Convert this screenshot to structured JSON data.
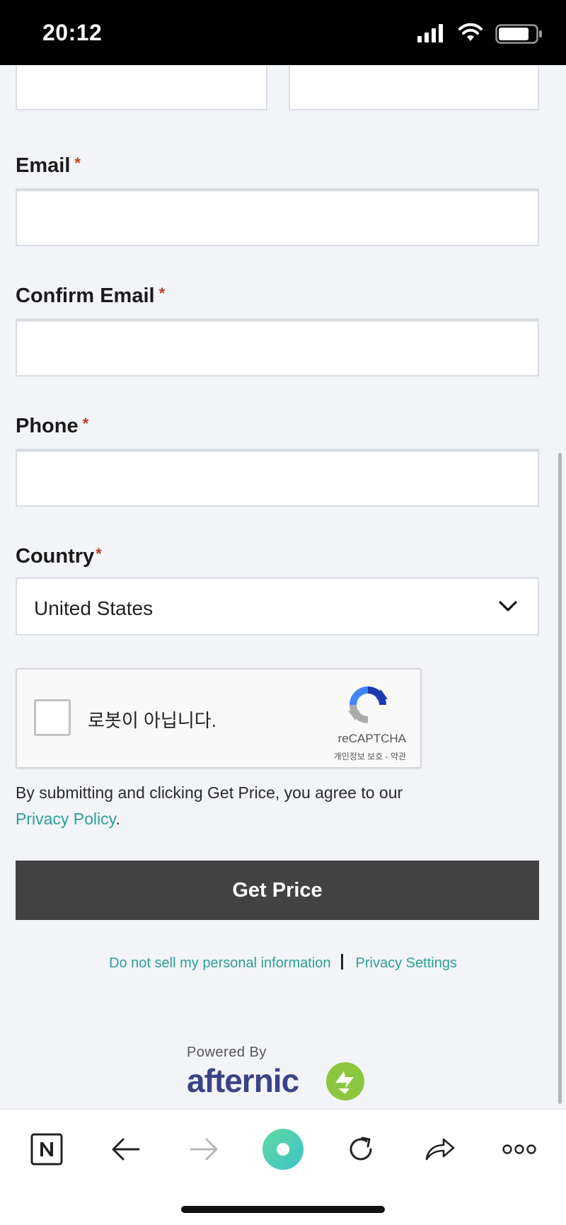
{
  "status_bar": {
    "time": "20:12"
  },
  "form": {
    "email": {
      "label": "Email",
      "required": "*",
      "value": ""
    },
    "confirm_email": {
      "label": "Confirm Email",
      "required": "*",
      "value": ""
    },
    "phone": {
      "label": "Phone",
      "required": "*",
      "value": ""
    },
    "country": {
      "label": "Country",
      "required": "*",
      "selected": "United States"
    }
  },
  "recaptcha": {
    "label": "로봇이 아닙니다.",
    "brand": "reCAPTCHA",
    "terms": "개인정보 보호 - 약관"
  },
  "agreement": {
    "text": "By submitting and clicking Get Price, you agree to our ",
    "link": "Privacy Policy",
    "suffix": "."
  },
  "submit": {
    "label": "Get Price"
  },
  "footer": {
    "do_not_sell": "Do not sell my personal information",
    "privacy_settings": "Privacy Settings",
    "powered_by": "Powered By",
    "brand": "afternic"
  },
  "colors": {
    "link": "#2e9e9b",
    "button": "#424242",
    "required": "#c0392b",
    "brand_text": "#3a4388",
    "brand_icon": "#8cc63f"
  },
  "toolbar": {
    "icons": [
      "naver-icon",
      "back-arrow-icon",
      "forward-arrow-icon",
      "green-dot-icon",
      "reload-icon",
      "share-icon",
      "more-icon"
    ]
  }
}
